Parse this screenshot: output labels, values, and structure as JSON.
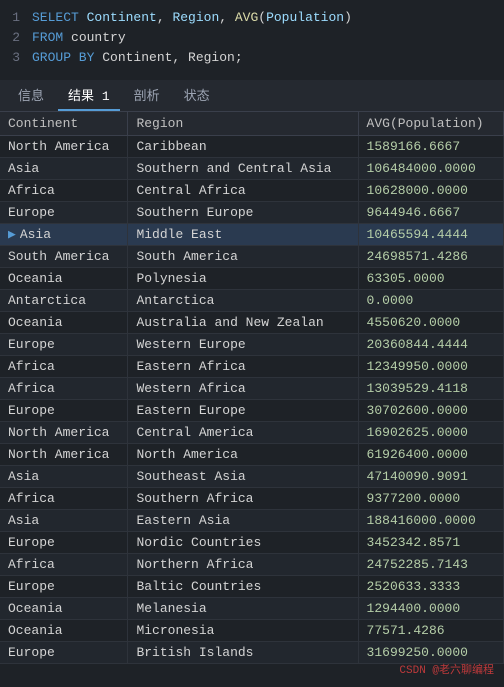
{
  "code": {
    "lines": [
      {
        "number": "1",
        "tokens": [
          {
            "type": "kw",
            "text": "SELECT "
          },
          {
            "type": "id",
            "text": "Continent"
          },
          {
            "type": "plain",
            "text": ", "
          },
          {
            "type": "id",
            "text": "Region"
          },
          {
            "type": "plain",
            "text": ", "
          },
          {
            "type": "fn",
            "text": "AVG"
          },
          {
            "type": "plain",
            "text": "("
          },
          {
            "type": "id",
            "text": "Population"
          },
          {
            "type": "plain",
            "text": ")"
          }
        ]
      },
      {
        "number": "2",
        "tokens": [
          {
            "type": "kw",
            "text": "FROM "
          },
          {
            "type": "plain",
            "text": "country"
          }
        ]
      },
      {
        "number": "3",
        "tokens": [
          {
            "type": "kw",
            "text": "GROUP BY "
          },
          {
            "type": "plain",
            "text": "Continent, Region;"
          }
        ]
      }
    ]
  },
  "tabs": [
    {
      "label": "信息",
      "active": false
    },
    {
      "label": "结果 1",
      "active": true
    },
    {
      "label": "剖析",
      "active": false
    },
    {
      "label": "状态",
      "active": false
    }
  ],
  "table": {
    "headers": [
      "Continent",
      "Region",
      "AVG(Population)"
    ],
    "rows": [
      [
        "North America",
        "Caribbean",
        "1589166.6667"
      ],
      [
        "Asia",
        "Southern and Central Asia",
        "106484000.0000"
      ],
      [
        "Africa",
        "Central Africa",
        "10628000.0000"
      ],
      [
        "Europe",
        "Southern Europe",
        "9644946.6667"
      ],
      [
        "Asia",
        "Middle East",
        "10465594.4444"
      ],
      [
        "South America",
        "South America",
        "24698571.4286"
      ],
      [
        "Oceania",
        "Polynesia",
        "63305.0000"
      ],
      [
        "Antarctica",
        "Antarctica",
        "0.0000"
      ],
      [
        "Oceania",
        "Australia and New Zealan",
        "4550620.0000"
      ],
      [
        "Europe",
        "Western Europe",
        "20360844.4444"
      ],
      [
        "Africa",
        "Eastern Africa",
        "12349950.0000"
      ],
      [
        "Africa",
        "Western Africa",
        "13039529.4118"
      ],
      [
        "Europe",
        "Eastern Europe",
        "30702600.0000"
      ],
      [
        "North America",
        "Central America",
        "16902625.0000"
      ],
      [
        "North America",
        "North America",
        "61926400.0000"
      ],
      [
        "Asia",
        "Southeast Asia",
        "47140090.9091"
      ],
      [
        "Africa",
        "Southern Africa",
        "9377200.0000"
      ],
      [
        "Asia",
        "Eastern Asia",
        "188416000.0000"
      ],
      [
        "Europe",
        "Nordic Countries",
        "3452342.8571"
      ],
      [
        "Africa",
        "Northern Africa",
        "24752285.7143"
      ],
      [
        "Europe",
        "Baltic Countries",
        "2520633.3333"
      ],
      [
        "Oceania",
        "Melanesia",
        "1294400.0000"
      ],
      [
        "Oceania",
        "Micronesia",
        "77571.4286"
      ],
      [
        "Europe",
        "British Islands",
        "31699250.0000"
      ]
    ],
    "selected_row": 5
  },
  "watermark": "CSDN @老六聊编程"
}
